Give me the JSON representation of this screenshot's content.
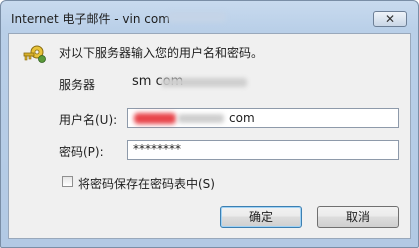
{
  "window": {
    "title": "Internet 电子邮件 - vin                    com",
    "close_symbol": "✕"
  },
  "prompt": "对以下服务器输入您的用户名和密码。",
  "server": {
    "label": "服务器",
    "value": "sm                     com"
  },
  "username": {
    "label": "用户名(U):",
    "value": "com"
  },
  "password": {
    "label": "密码(P):",
    "value": "********"
  },
  "remember": {
    "label": "将密码保存在密码表中(S)",
    "checked": false
  },
  "buttons": {
    "ok": "确定",
    "cancel": "取消"
  },
  "icons": {
    "key": "key-icon",
    "close": "close-icon"
  }
}
